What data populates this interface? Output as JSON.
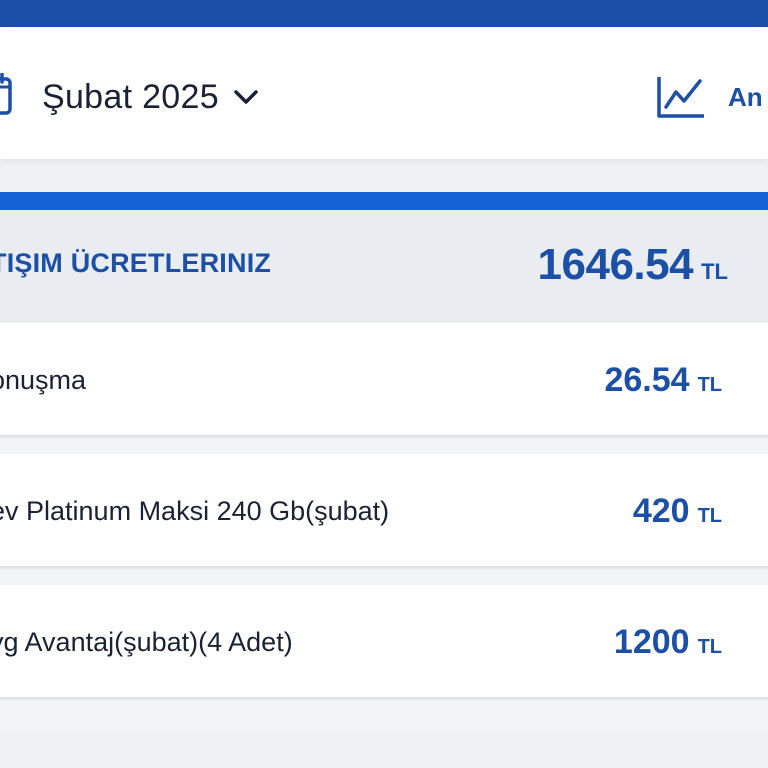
{
  "header": {
    "month": "Şubat 2025",
    "analysis_label": "An",
    "icons": {
      "calendar": "calendar-icon",
      "chevron": "chevron-down-icon",
      "chart": "line-chart-icon"
    }
  },
  "summary": {
    "title": "TIŞIM ÜCRETLERINIZ",
    "amount": "1646.54",
    "currency": "TL"
  },
  "items": [
    {
      "label": "onuşma",
      "amount": "26.54",
      "currency": "TL"
    },
    {
      "label": "ev Platinum Maksi 240 Gb(şubat)",
      "amount": "420",
      "currency": "TL"
    },
    {
      "label": "yg Avantaj(şubat)(4 Adet)",
      "amount": "1200",
      "currency": "TL"
    }
  ],
  "colors": {
    "brand": "#1c4fa6",
    "accent_bar": "#1561d6",
    "text": "#1a2233"
  }
}
